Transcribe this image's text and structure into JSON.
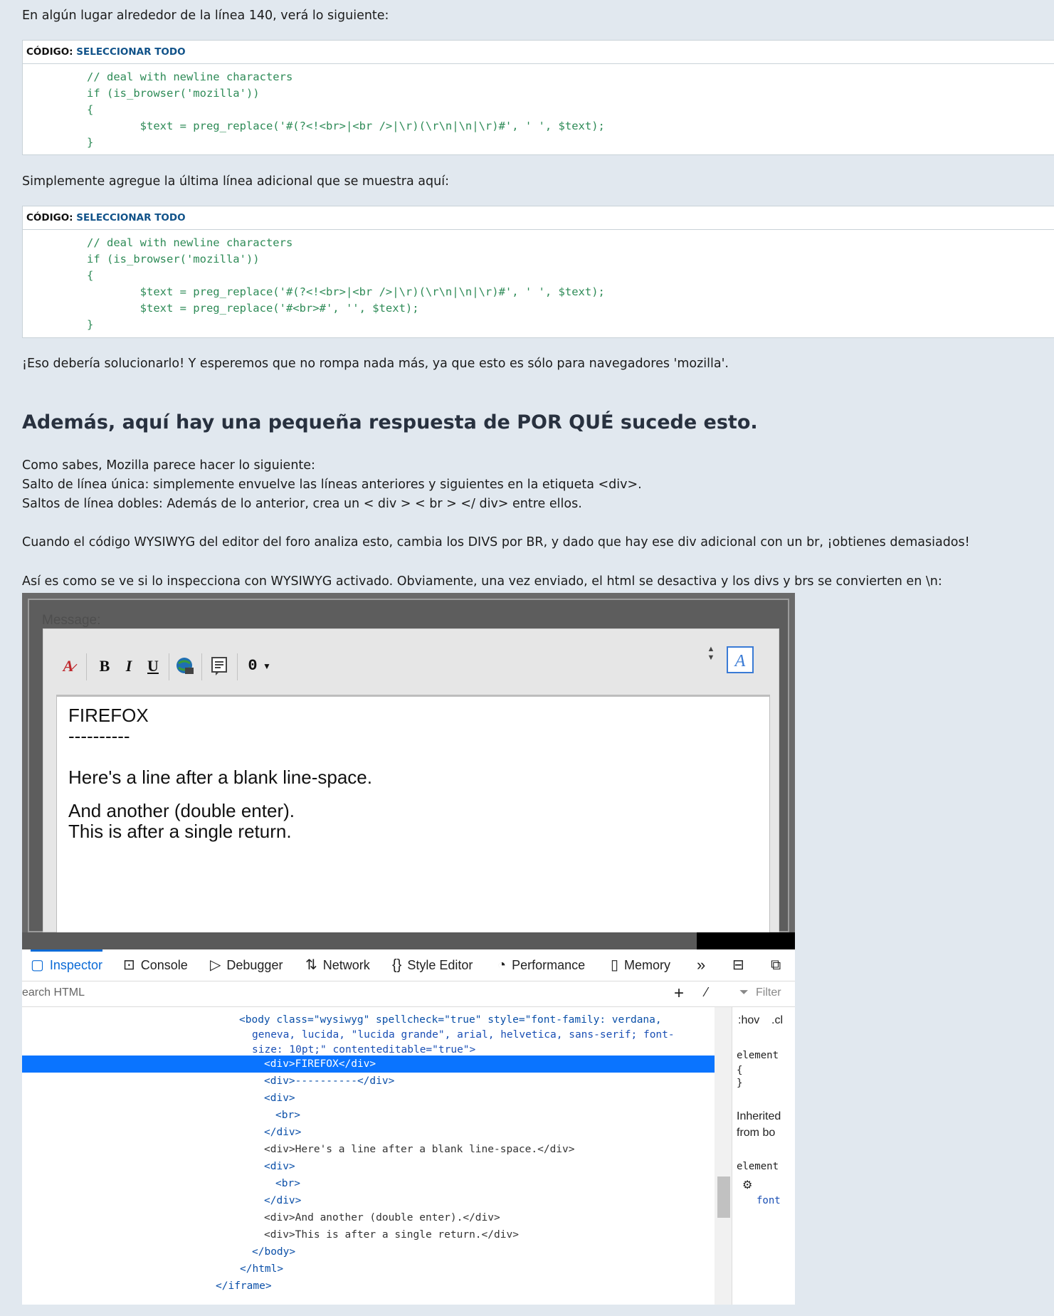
{
  "intro1": "En algún lugar alrededor de la línea 140, verá lo siguiente:",
  "code_label": "CÓDIGO:",
  "select_all": "SELECCIONAR TODO",
  "code1": "// deal with newline characters\nif (is_browser('mozilla'))\n{\n        $text = preg_replace('#(?<!<br>|<br />|\\r)(\\r\\n|\\n|\\r)#', ' ', $text);\n}",
  "intro2": "Simplemente agregue la última línea adicional que se muestra aquí:",
  "code2": "// deal with newline characters\nif (is_browser('mozilla'))\n{\n        $text = preg_replace('#(?<!<br>|<br />|\\r)(\\r\\n|\\n|\\r)#', ' ', $text);\n        $text = preg_replace('#<br>#', '', $text);\n}",
  "outro": "¡Eso debería solucionarlo! Y esperemos que no rompa nada más, ya que esto es sólo para navegadores 'mozilla'.",
  "heading": "Además, aquí hay una pequeña respuesta de POR QUÉ sucede esto.",
  "explain1": "Como sabes, Mozilla parece hacer lo siguiente:",
  "explain2": "Salto de línea única: simplemente envuelve las líneas anteriores y siguientes en la etiqueta <div>.",
  "explain3": "Saltos de línea dobles: Además de lo anterior, crea un < div > < br > </ div> entre ellos.",
  "explain4": "Cuando el código WYSIWYG del editor del foro analiza esto, cambia los DIVS por BR, y dado que hay ese div adicional con un br, ¡obtienes demasiados!",
  "explain5": "Así es como se ve si lo inspecciona con WYSIWYG activado. Obviamente, una vez enviado, el html se desactiva y los divs y brs se convierten en \\n:",
  "screenshot": {
    "message_label": "Message:",
    "toolbar": {
      "bold": "B",
      "italic": "I",
      "underline": "U",
      "attach": "0"
    },
    "editor_lines": [
      "FIREFOX",
      "----------",
      "",
      "Here's a line after a blank line-space.",
      "",
      "And another (double enter).",
      "This is after a single return."
    ],
    "tabs": [
      "Inspector",
      "Console",
      "Debugger",
      "Network",
      "Style Editor",
      "Performance",
      "Memory"
    ],
    "search_placeholder": "earch HTML",
    "filter_placeholder": "Filter",
    "rules_hov": ":hov",
    "rules_cls": ".cl",
    "element_label": "element",
    "inherited_label": "Inherited",
    "from_label": "from bo",
    "font_label": "font",
    "html_lines": {
      "body1": "<body class=\"wysiwyg\" spellcheck=\"true\" style=\"font-family: verdana,",
      "body2": "geneva, lucida, \"lucida grande\", arial, helvetica, sans-serif; font-",
      "body3": "size: 10pt;\" contenteditable=\"true\">",
      "l1": "<div>FIREFOX</div>",
      "l2": "<div>----------</div>",
      "l3": "<div>",
      "l4": "<br>",
      "l5": "</div>",
      "l6": "<div>Here's a line after a blank line-space.</div>",
      "l7": "<div>",
      "l8": "<br>",
      "l9": "</div>",
      "l10": "<div>And another (double enter).</div>",
      "l11": "<div>This is after a single return.</div>",
      "l12": "</body>",
      "l13": "</html>",
      "l14": "</iframe>"
    }
  },
  "colors": {
    "page_bg": "#e1e8ef",
    "link": "#105289",
    "code": "#2e8b57",
    "devtools_accent": "#0a74ff"
  }
}
